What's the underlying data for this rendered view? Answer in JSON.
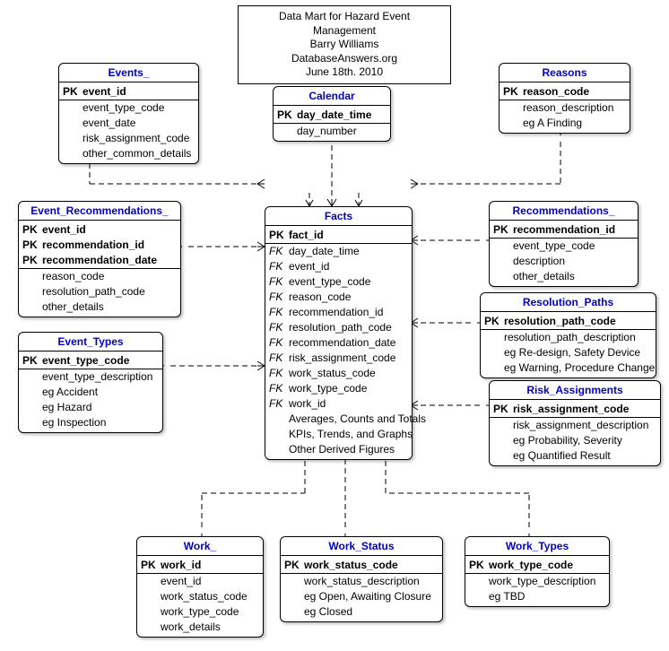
{
  "header": {
    "line1": "Data Mart for Hazard Event Management",
    "line2": "Barry Williams",
    "line3": "DatabaseAnswers.org",
    "line4": "June 18th. 2010"
  },
  "entities": {
    "events": {
      "title": "Events_",
      "rows": [
        {
          "key": "PK",
          "attr": "event_id",
          "pk": true
        },
        {
          "key": "",
          "attr": "event_type_code"
        },
        {
          "key": "",
          "attr": "event_date"
        },
        {
          "key": "",
          "attr": "risk_assignment_code"
        },
        {
          "key": "",
          "attr": "other_common_details"
        }
      ]
    },
    "calendar": {
      "title": "Calendar",
      "rows": [
        {
          "key": "PK",
          "attr": "day_date_time",
          "pk": true
        },
        {
          "key": "",
          "attr": "day_number"
        }
      ]
    },
    "reasons": {
      "title": "Reasons",
      "rows": [
        {
          "key": "PK",
          "attr": "reason_code",
          "pk": true
        },
        {
          "key": "",
          "attr": "reason_description"
        },
        {
          "key": "",
          "attr": "eg A Finding"
        }
      ]
    },
    "event_recommendations": {
      "title": "Event_Recommendations_",
      "rows": [
        {
          "key": "PK",
          "attr": "event_id",
          "pk": true
        },
        {
          "key": "PK",
          "attr": "recommendation_id",
          "pk": true
        },
        {
          "key": "PK",
          "attr": "recommendation_date",
          "pk": true
        },
        {
          "key": "",
          "attr": "reason_code"
        },
        {
          "key": "",
          "attr": "resolution_path_code"
        },
        {
          "key": "",
          "attr": "other_details"
        }
      ]
    },
    "recommendations": {
      "title": "Recommendations_",
      "rows": [
        {
          "key": "PK",
          "attr": "recommendation_id",
          "pk": true
        },
        {
          "key": "",
          "attr": "event_type_code"
        },
        {
          "key": "",
          "attr": "description"
        },
        {
          "key": "",
          "attr": "other_details"
        }
      ]
    },
    "facts": {
      "title": "Facts",
      "rows": [
        {
          "key": "PK",
          "attr": "fact_id",
          "pk": true
        },
        {
          "key": "FK",
          "attr": "day_date_time",
          "fk": true
        },
        {
          "key": "FK",
          "attr": "event_id",
          "fk": true
        },
        {
          "key": "FK",
          "attr": "event_type_code",
          "fk": true
        },
        {
          "key": "FK",
          "attr": "reason_code",
          "fk": true
        },
        {
          "key": "FK",
          "attr": "recommendation_id",
          "fk": true
        },
        {
          "key": "FK",
          "attr": "resolution_path_code",
          "fk": true
        },
        {
          "key": "FK",
          "attr": "recommendation_date",
          "fk": true
        },
        {
          "key": "FK",
          "attr": "risk_assignment_code",
          "fk": true
        },
        {
          "key": "FK",
          "attr": "work_status_code",
          "fk": true
        },
        {
          "key": "FK",
          "attr": "work_type_code",
          "fk": true
        },
        {
          "key": "FK",
          "attr": "work_id",
          "fk": true
        },
        {
          "key": "",
          "attr": "Averages, Counts and Totals"
        },
        {
          "key": "",
          "attr": "KPIs, Trends, and Graphs"
        },
        {
          "key": "",
          "attr": "Other Derived Figures"
        }
      ]
    },
    "resolution_paths": {
      "title": "Resolution_Paths",
      "rows": [
        {
          "key": "PK",
          "attr": "resolution_path_code",
          "pk": true
        },
        {
          "key": "",
          "attr": "resolution_path_description"
        },
        {
          "key": "",
          "attr": "eg Re-design, Safety Device"
        },
        {
          "key": "",
          "attr": "eg Warning, Procedure Change"
        }
      ]
    },
    "event_types": {
      "title": "Event_Types",
      "rows": [
        {
          "key": "PK",
          "attr": "event_type_code",
          "pk": true
        },
        {
          "key": "",
          "attr": "event_type_description"
        },
        {
          "key": "",
          "attr": "eg Accident"
        },
        {
          "key": "",
          "attr": "eg Hazard"
        },
        {
          "key": "",
          "attr": "eg Inspection"
        }
      ]
    },
    "risk_assignments": {
      "title": "Risk_Assignments",
      "rows": [
        {
          "key": "PK",
          "attr": "risk_assignment_code",
          "pk": true
        },
        {
          "key": "",
          "attr": "risk_assignment_description"
        },
        {
          "key": "",
          "attr": "eg Probability, Severity"
        },
        {
          "key": "",
          "attr": "eg Quantified Result"
        }
      ]
    },
    "work": {
      "title": "Work_",
      "rows": [
        {
          "key": "PK",
          "attr": "work_id",
          "pk": true
        },
        {
          "key": "",
          "attr": "event_id"
        },
        {
          "key": "",
          "attr": "work_status_code"
        },
        {
          "key": "",
          "attr": "work_type_code"
        },
        {
          "key": "",
          "attr": "work_details"
        }
      ]
    },
    "work_status": {
      "title": "Work_Status",
      "rows": [
        {
          "key": "PK",
          "attr": "work_status_code",
          "pk": true
        },
        {
          "key": "",
          "attr": "work_status_description"
        },
        {
          "key": "",
          "attr": "eg Open, Awaiting Closure"
        },
        {
          "key": "",
          "attr": "eg Closed"
        }
      ]
    },
    "work_types": {
      "title": "Work_Types",
      "rows": [
        {
          "key": "PK",
          "attr": "work_type_code",
          "pk": true
        },
        {
          "key": "",
          "attr": "work_type_description"
        },
        {
          "key": "",
          "attr": "eg TBD"
        }
      ]
    }
  }
}
